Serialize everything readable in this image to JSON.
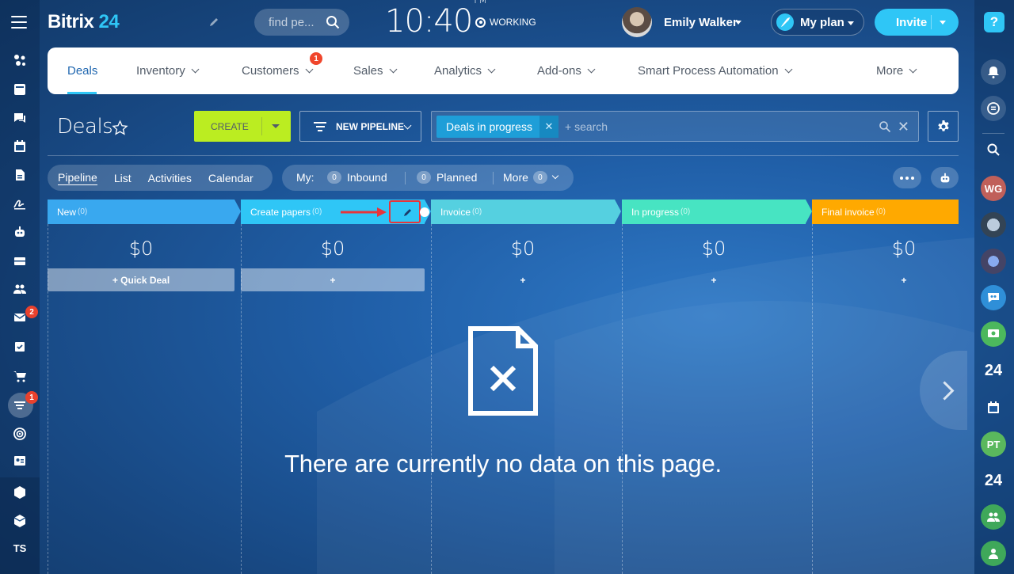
{
  "app": {
    "logo_main": "Bitrix",
    "logo_num": "24"
  },
  "header": {
    "search_placeholder": "find pe...",
    "time": "10:40",
    "ampm": "PM",
    "status": "WORKING",
    "user_name": "Emily Walker",
    "plan_label": "My plan",
    "invite_label": "Invite"
  },
  "left_sidebar": {
    "badges": {
      "mail": "2",
      "funnel": "1"
    },
    "bottom_label": "TS"
  },
  "nav": {
    "items": [
      {
        "label": "Deals",
        "active": true
      },
      {
        "label": "Inventory"
      },
      {
        "label": "Customers",
        "badge": "1"
      },
      {
        "label": "Sales"
      },
      {
        "label": "Analytics"
      },
      {
        "label": "Add-ons"
      },
      {
        "label": "Smart Process Automation"
      },
      {
        "label": "More"
      }
    ]
  },
  "toolbar": {
    "title": "Deals",
    "create_label": "CREATE",
    "pipeline_label": "NEW PIPELINE",
    "filter_chip": "Deals in progress",
    "search_placeholder": "+ search"
  },
  "views": {
    "tabs": [
      "Pipeline",
      "List",
      "Activities",
      "Calendar"
    ],
    "active": "Pipeline",
    "my_label": "My:",
    "inbound_count": "0",
    "inbound_label": "Inbound",
    "planned_count": "0",
    "planned_label": "Planned",
    "more_count": "0",
    "more_label": "More"
  },
  "columns": [
    {
      "name": "New",
      "count": "(0)",
      "sum": "$0",
      "add_label": "+ Quick Deal",
      "color": "#39a8ef"
    },
    {
      "name": "Create papers",
      "count": "(0)",
      "sum": "$0",
      "add_label": "+",
      "color": "#2fc6f6"
    },
    {
      "name": "Invoice",
      "count": "(0)",
      "sum": "$0",
      "add_label": "+",
      "color": "#55d0e0"
    },
    {
      "name": "In progress",
      "count": "(0)",
      "sum": "$0",
      "add_label": "+",
      "color": "#47e4c2"
    },
    {
      "name": "Final invoice",
      "count": "(0)",
      "sum": "$0",
      "add_label": "+",
      "color": "#ffa900"
    }
  ],
  "empty_state": {
    "message": "There are currently no data on this page."
  },
  "right_sidebar": {
    "help_label": "?",
    "initials_wg": "WG",
    "label_24_a": "24",
    "initials_pt": "PT",
    "label_24_b": "24"
  },
  "colors": {
    "accent": "#2fc6f6",
    "create": "#bbed21",
    "highlight": "#e8343a"
  }
}
